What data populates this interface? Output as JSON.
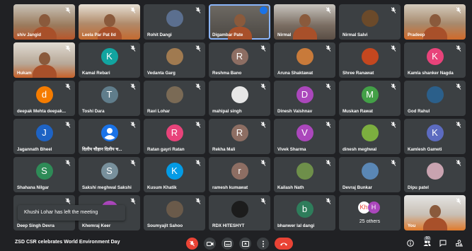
{
  "participants": [
    {
      "name": "shiv Jangid",
      "type": "video",
      "style": "v1"
    },
    {
      "name": "Leela Par Pat Ild",
      "type": "video",
      "style": "v2"
    },
    {
      "name": "Rohit Dangi",
      "type": "photo",
      "color": "#5b6f8f"
    },
    {
      "name": "Digambar Pate",
      "type": "video",
      "style": "v3",
      "active": true
    },
    {
      "name": "Nirmal",
      "type": "video",
      "style": "v4"
    },
    {
      "name": "Nirmal Salvi",
      "type": "photo",
      "color": "#6b4a2a"
    },
    {
      "name": "Pradeep",
      "type": "video",
      "style": "v5"
    },
    {
      "name": "Hukam",
      "type": "video",
      "style": "v6"
    },
    {
      "name": "Kamal Rebari",
      "type": "letter",
      "letter": "K",
      "color": "#12a4a0"
    },
    {
      "name": "Vedanta Garg",
      "type": "photo",
      "color": "#a07a50"
    },
    {
      "name": "Reshma Bano",
      "type": "letter",
      "letter": "R",
      "color": "#8d6e63"
    },
    {
      "name": "Aruna Shaktawat",
      "type": "photo",
      "color": "#c87a3a"
    },
    {
      "name": "Shree Ranawat",
      "type": "photo",
      "color": "#c4471f"
    },
    {
      "name": "Kamla shanker Nagda",
      "type": "letter",
      "letter": "K",
      "color": "#e8437a"
    },
    {
      "name": "deepak Mehta deepak...",
      "type": "letter",
      "letter": "d",
      "color": "#f57c00"
    },
    {
      "name": "Toshi Dara",
      "type": "letter",
      "letter": "T",
      "color": "#607d8b"
    },
    {
      "name": "Ravi Lohar",
      "type": "photo",
      "color": "#7a6a55"
    },
    {
      "name": "mahipal singh",
      "type": "photo",
      "color": "#e6e6e6"
    },
    {
      "name": "Dinesh Vaishnav",
      "type": "letter",
      "letter": "D",
      "color": "#ab47bc"
    },
    {
      "name": "Muskan Rawat",
      "type": "letter",
      "letter": "M",
      "color": "#43a047"
    },
    {
      "name": "God Rahul",
      "type": "photo",
      "color": "#2b5f8a"
    },
    {
      "name": "Jagannath Bheel",
      "type": "letter",
      "letter": "J",
      "color": "#1e63c4"
    },
    {
      "name": "दिलीप चौहान दिलीप च...",
      "type": "user-icon",
      "color": "#1a73e8"
    },
    {
      "name": "Ratan gayri Ratan",
      "type": "letter",
      "letter": "R",
      "color": "#e8437a"
    },
    {
      "name": "Rekha Mali",
      "type": "letter",
      "letter": "R",
      "color": "#8d6e63"
    },
    {
      "name": "Vivek Sharma",
      "type": "letter",
      "letter": "V",
      "color": "#ab47bc"
    },
    {
      "name": "dinesh meghwal",
      "type": "photo",
      "color": "#7cae3f"
    },
    {
      "name": "Kamlesh Gameti",
      "type": "letter",
      "letter": "K",
      "color": "#5c6bc0"
    },
    {
      "name": "Shahana Nilgar",
      "type": "letter",
      "letter": "S",
      "color": "#2e8b57"
    },
    {
      "name": "Sakshi meghwal Sakshi",
      "type": "letter",
      "letter": "S",
      "color": "#78909c"
    },
    {
      "name": "Kusum Khatik",
      "type": "letter",
      "letter": "K",
      "color": "#039be5"
    },
    {
      "name": "ramesh kumawat",
      "type": "letter",
      "letter": "r",
      "color": "#8d6e63"
    },
    {
      "name": "Kailash Nath",
      "type": "photo",
      "color": "#6e8f4a"
    },
    {
      "name": "Devraj Bunkar",
      "type": "photo",
      "color": "#5a87b5"
    },
    {
      "name": "Dipu patel",
      "type": "photo",
      "color": "#c9a3b0"
    },
    {
      "name": "Deep Singh Devra",
      "type": "letter",
      "letter": "",
      "color": "#3c4043"
    },
    {
      "name": "Khemraj Keer",
      "type": "letter",
      "letter": "",
      "color": "#ab47bc"
    },
    {
      "name": "Soumyajit Sahoo",
      "type": "photo",
      "color": "#6a5a4a"
    },
    {
      "name": "RDX HITESHYT",
      "type": "photo",
      "color": "#1c1c1c"
    },
    {
      "name": "bhanwer lal dangi",
      "type": "letter",
      "letter": "b",
      "color": "#2e7d5b"
    },
    {
      "name": "25 others",
      "type": "others"
    },
    {
      "name": "You",
      "type": "video",
      "style": "v8"
    }
  ],
  "others": {
    "a": "Kh",
    "b": "H"
  },
  "toast": "Khushi Lohar has left the meeting",
  "meeting_title": "ZSD CSR celebrates World Environment Day",
  "people_count": "60",
  "colors": {
    "background": "#202124",
    "tile": "#3c4043",
    "hangup": "#ea4335",
    "accent": "#1a73e8"
  }
}
